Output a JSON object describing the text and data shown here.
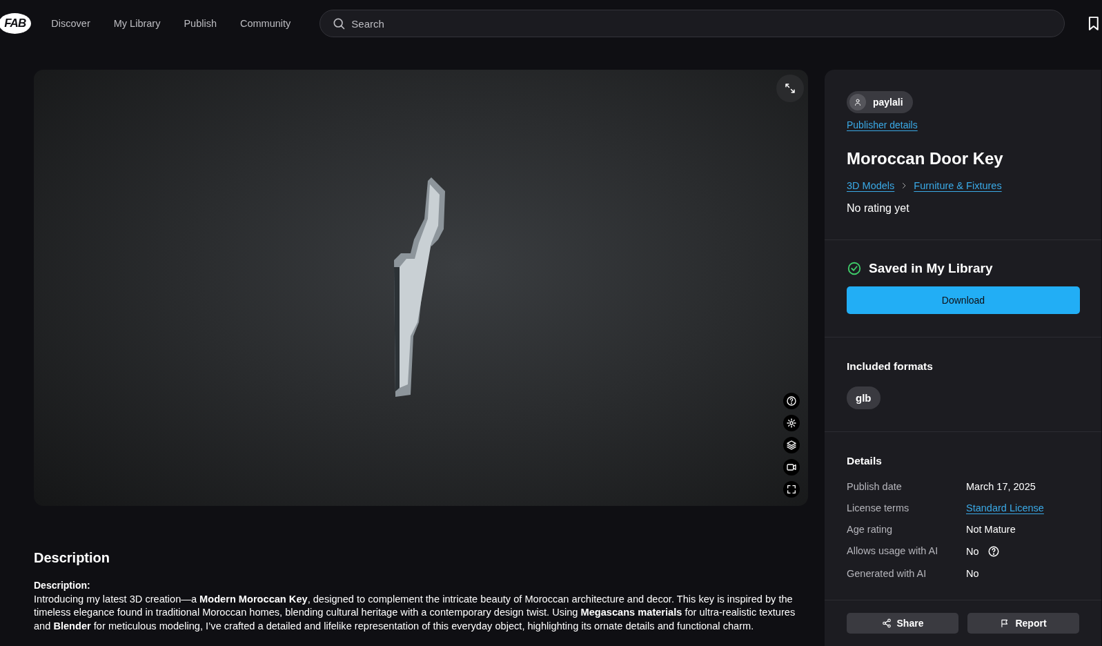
{
  "nav": {
    "logo": "FAB",
    "links": [
      {
        "label": "Discover"
      },
      {
        "label": "My Library"
      },
      {
        "label": "Publish"
      },
      {
        "label": "Community"
      }
    ],
    "search": {
      "placeholder": "Search"
    }
  },
  "publisher": {
    "name": "paylali",
    "link": "Publisher details"
  },
  "product": {
    "title": "Moroccan Door Key",
    "breadcrumbs": [
      "3D Models",
      "Furniture & Fixtures"
    ],
    "rating": "No rating yet"
  },
  "library": {
    "saved": true,
    "status": "Saved in My Library",
    "button": "Download"
  },
  "formats": {
    "heading": "Included formats",
    "items": [
      "glb"
    ]
  },
  "details": {
    "heading": "Details",
    "rows": [
      {
        "label": "Publish date",
        "value": "March 17, 2025",
        "kind": "text"
      },
      {
        "label": "License terms",
        "value": "Standard License",
        "kind": "link"
      },
      {
        "label": "Age rating",
        "value": "Not Mature",
        "kind": "text"
      },
      {
        "label": "Allows usage with AI",
        "value": "No",
        "kind": "info"
      },
      {
        "label": "Generated with AI",
        "value": "No",
        "kind": "text"
      }
    ]
  },
  "actions": [
    {
      "label": "Share",
      "kind": "share"
    },
    {
      "label": "Report",
      "kind": "report"
    }
  ],
  "description": {
    "heading": "Description",
    "subheading": "Description:",
    "text": "Introducing my latest 3D creation—a **Modern Moroccan Key**, designed to complement the intricate beauty of Moroccan architecture and decor. This key is inspired by the timeless elegance found in traditional Moroccan homes, blending cultural heritage with a contemporary design twist. Using **Megascans materials** for ultra-realistic textures and **Blender** for meticulous modeling, I’ve crafted a detailed and lifelike representation of this everyday object, highlighting its ornate details and functional charm."
  }
}
